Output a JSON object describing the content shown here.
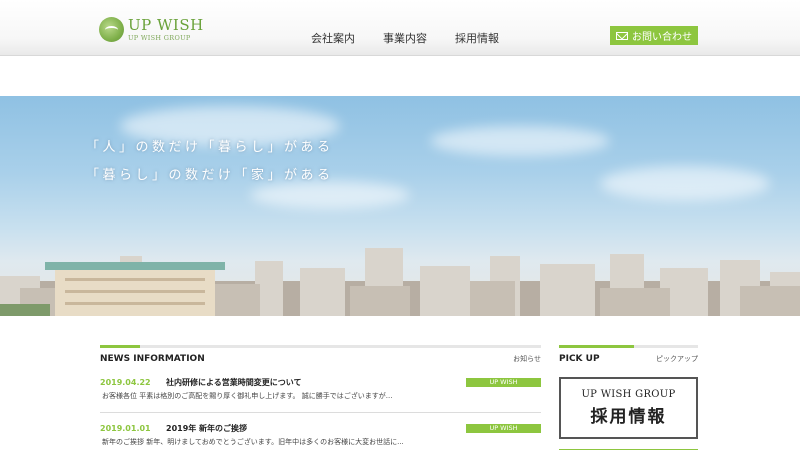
{
  "header": {
    "logo_main": "UP WISH",
    "logo_sub": "UP WISH GROUP",
    "nav": [
      "会社案内",
      "事業内容",
      "採用情報"
    ],
    "contact_label": "お問い合わせ"
  },
  "hero": {
    "line1": "「人」の数だけ「暮らし」がある",
    "line2": "「暮らし」の数だけ「家」がある"
  },
  "news": {
    "title": "NEWS INFORMATION",
    "more_label": "お知らせ",
    "items": [
      {
        "date": "2019.04.22",
        "subject": "社内研修による営業時間変更について",
        "category": "UP WISH",
        "excerpt": "お客様各位 平素は格別のご高配を賜り厚く御礼申し上げます。 誠に勝手ではございますが..."
      },
      {
        "date": "2019.01.01",
        "subject": "2019年 新年のご挨拶",
        "category": "UP WISH",
        "excerpt": "新年のご挨拶 新年、明けましておめでとうございます。旧年中は多くのお客様に大変お世話に..."
      }
    ]
  },
  "pickup": {
    "title": "PICK UP",
    "sub_label": "ピックアップ",
    "banner_en": "UP WISH GROUP",
    "banner_jp": "採用情報"
  },
  "colors": {
    "accent": "#8dc63f",
    "sky": "#a9d0ea"
  },
  "icons": {
    "logo": "leaf-circle-logo-icon",
    "contact": "mail-icon"
  }
}
